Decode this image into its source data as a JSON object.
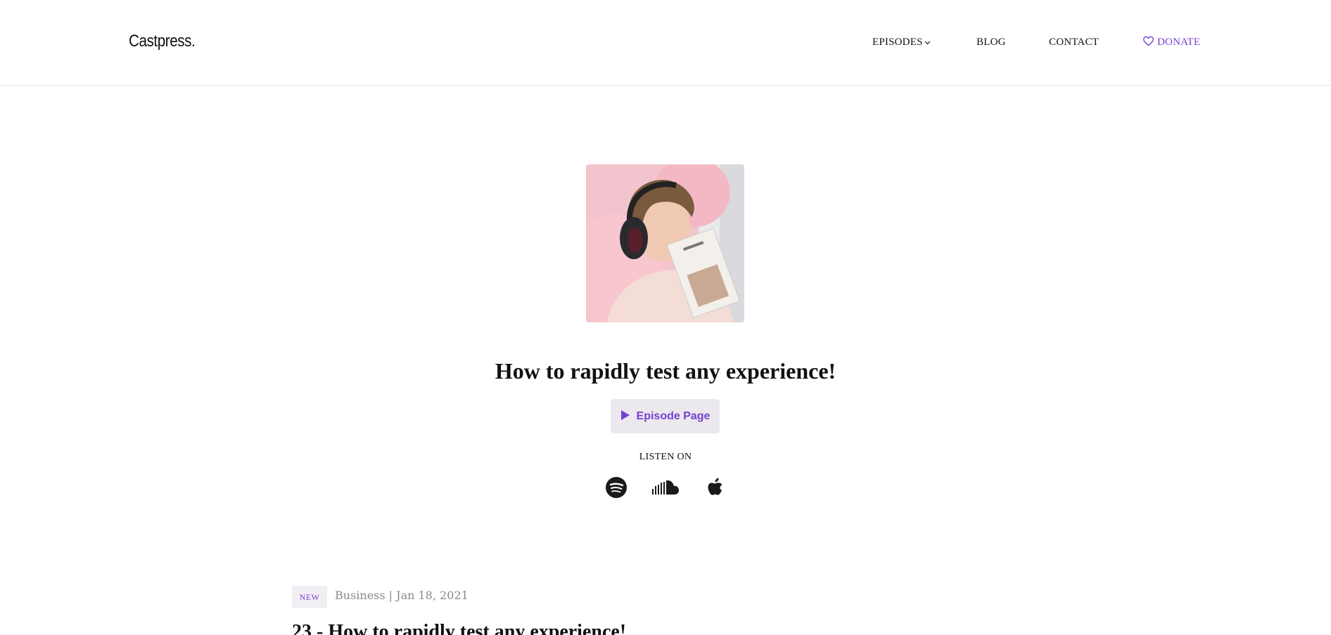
{
  "brand": {
    "logo": "Castpress."
  },
  "nav": {
    "episodes": "EPISODES",
    "blog": "BLOG",
    "contact": "CONTACT",
    "donate": "DONATE"
  },
  "hero": {
    "image_alt": "Woman wearing headphones holding a book",
    "title": "How to rapidly test any experience!",
    "episode_button": "Episode Page",
    "listen_on": "LISTEN ON",
    "services": [
      "spotify-icon",
      "soundcloud-icon",
      "apple-icon"
    ]
  },
  "latest_post": {
    "badge": "NEW",
    "meta": "Business | Jan 18, 2021",
    "title": "23 - How to rapidly test any experience!"
  },
  "colors": {
    "accent": "#7540cf",
    "button_bg": "#ebe8ee",
    "text": "#111111",
    "muted": "#8a8a8a"
  }
}
